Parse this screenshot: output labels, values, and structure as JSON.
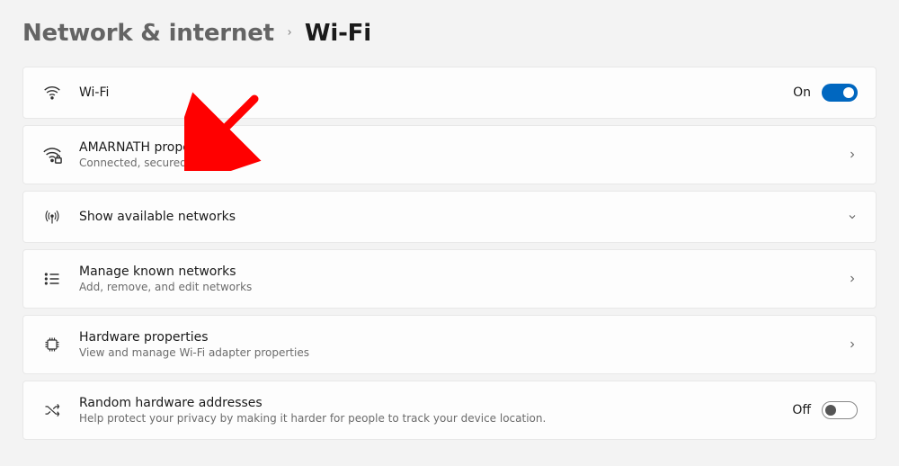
{
  "breadcrumb": {
    "parent": "Network & internet",
    "current": "Wi-Fi"
  },
  "rows": {
    "wifi": {
      "title": "Wi-Fi",
      "toggle_label": "On",
      "toggle_on": true
    },
    "connected": {
      "title": "AMARNATH properties",
      "sub": "Connected, secured"
    },
    "available": {
      "title": "Show available networks"
    },
    "manage": {
      "title": "Manage known networks",
      "sub": "Add, remove, and edit networks"
    },
    "hardware": {
      "title": "Hardware properties",
      "sub": "View and manage Wi-Fi adapter properties"
    },
    "random": {
      "title": "Random hardware addresses",
      "sub": "Help protect your privacy by making it harder for people to track your device location.",
      "toggle_label": "Off",
      "toggle_on": false
    }
  },
  "annotation": {
    "color": "#ff0000"
  }
}
